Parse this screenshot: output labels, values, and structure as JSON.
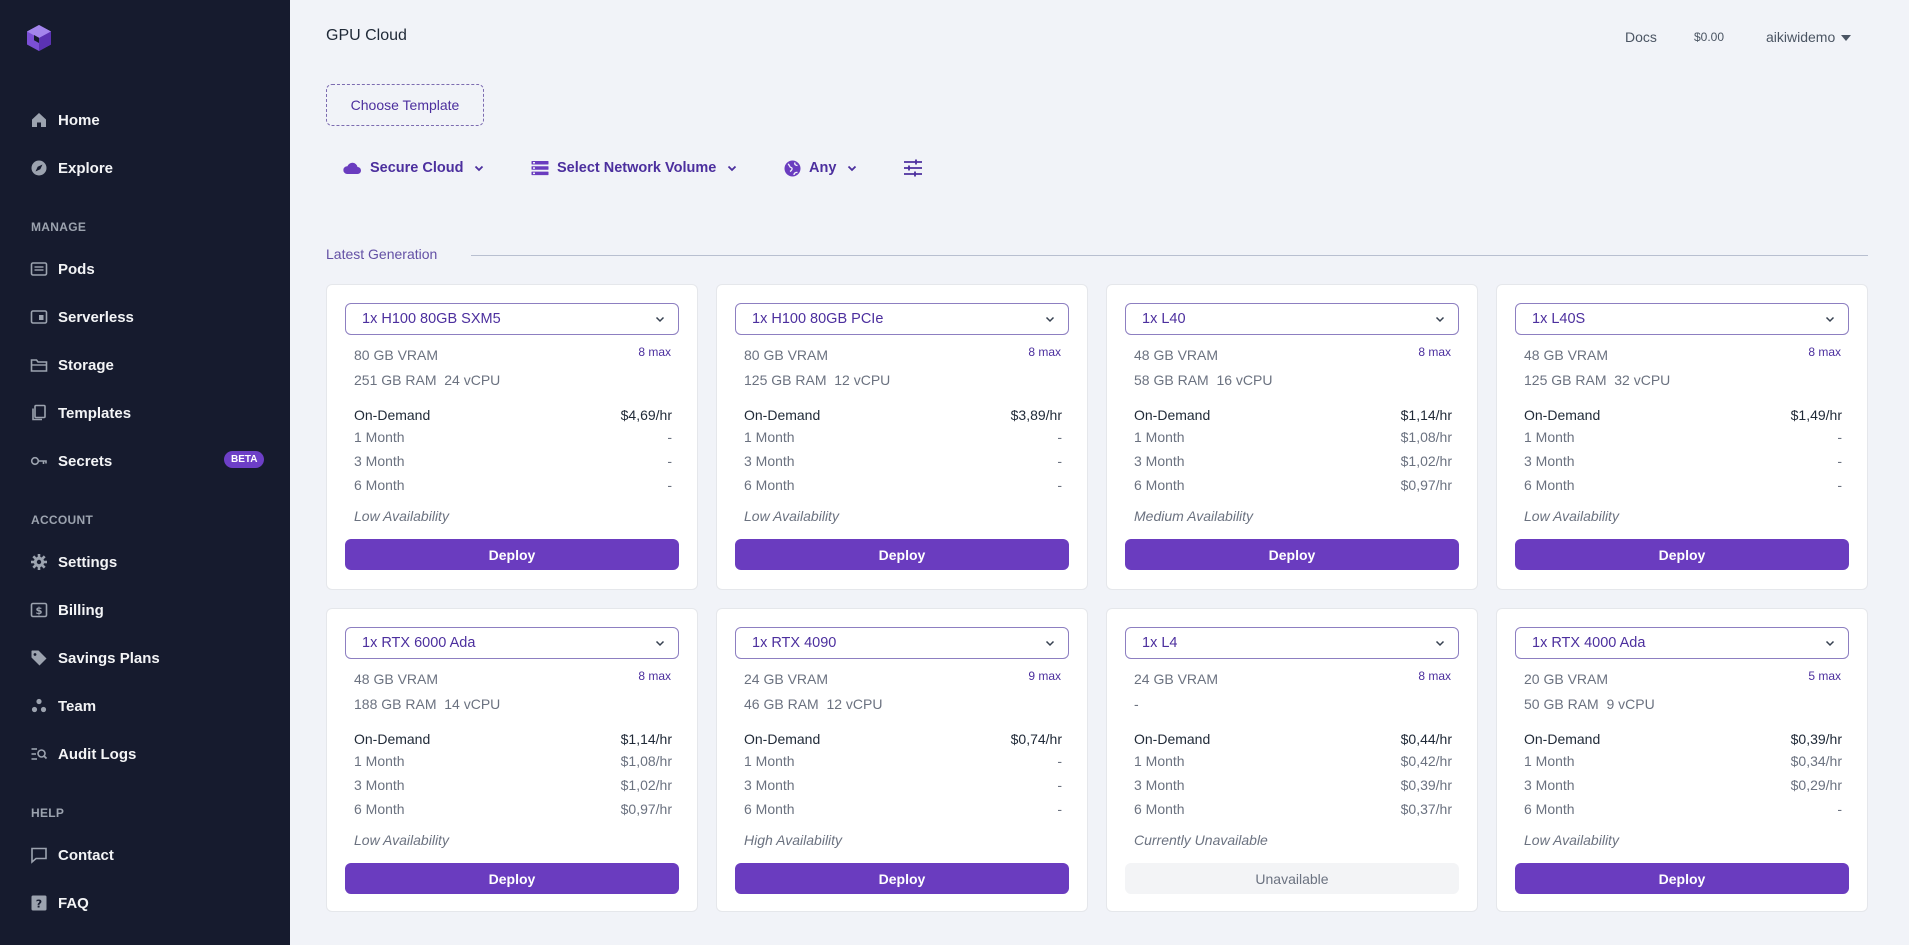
{
  "app": {
    "title": "GPU Cloud"
  },
  "header": {
    "docs": "Docs",
    "balance": "$0.00",
    "user": "aikiwidemo"
  },
  "sidebar": {
    "nav_top": [
      {
        "label": "Home",
        "icon": "home-icon"
      },
      {
        "label": "Explore",
        "icon": "compass-icon"
      }
    ],
    "manage_label": "MANAGE",
    "manage": [
      {
        "label": "Pods",
        "icon": "pods-icon"
      },
      {
        "label": "Serverless",
        "icon": "serverless-icon"
      },
      {
        "label": "Storage",
        "icon": "storage-icon"
      },
      {
        "label": "Templates",
        "icon": "templates-icon"
      },
      {
        "label": "Secrets",
        "icon": "key-icon",
        "badge": "BETA"
      }
    ],
    "account_label": "ACCOUNT",
    "account": [
      {
        "label": "Settings",
        "icon": "gear-icon"
      },
      {
        "label": "Billing",
        "icon": "billing-icon"
      },
      {
        "label": "Savings Plans",
        "icon": "tag-icon"
      },
      {
        "label": "Team",
        "icon": "team-icon"
      },
      {
        "label": "Audit Logs",
        "icon": "audit-icon"
      }
    ],
    "help_label": "HELP",
    "help": [
      {
        "label": "Contact",
        "icon": "chat-icon"
      },
      {
        "label": "FAQ",
        "icon": "question-icon"
      }
    ]
  },
  "main": {
    "choose_template": "Choose Template",
    "filters": {
      "cloud": "Secure Cloud",
      "volume": "Select Network Volume",
      "region": "Any"
    },
    "section_title": "Latest Generation",
    "price_labels": {
      "on_demand": "On-Demand",
      "m1": "1 Month",
      "m3": "3 Month",
      "m6": "6 Month"
    },
    "cards": [
      {
        "gpu": "1x H100 80GB SXM5",
        "vram": "80 GB VRAM",
        "max": "8 max",
        "ram_cpu": "251 GB RAM  24 vCPU",
        "on_demand": "$4,69/hr",
        "m1": "-",
        "m3": "-",
        "m6": "-",
        "availability": "Low Availability",
        "action": "Deploy",
        "available": true
      },
      {
        "gpu": "1x H100 80GB PCIe",
        "vram": "80 GB VRAM",
        "max": "8 max",
        "ram_cpu": "125 GB RAM  12 vCPU",
        "on_demand": "$3,89/hr",
        "m1": "-",
        "m3": "-",
        "m6": "-",
        "availability": "Low Availability",
        "action": "Deploy",
        "available": true
      },
      {
        "gpu": "1x L40",
        "vram": "48 GB VRAM",
        "max": "8 max",
        "ram_cpu": "58 GB RAM  16 vCPU",
        "on_demand": "$1,14/hr",
        "m1": "$1,08/hr",
        "m3": "$1,02/hr",
        "m6": "$0,97/hr",
        "availability": "Medium Availability",
        "action": "Deploy",
        "available": true
      },
      {
        "gpu": "1x L40S",
        "vram": "48 GB VRAM",
        "max": "8 max",
        "ram_cpu": "125 GB RAM  32 vCPU",
        "on_demand": "$1,49/hr",
        "m1": "-",
        "m3": "-",
        "m6": "-",
        "availability": "Low Availability",
        "action": "Deploy",
        "available": true
      },
      {
        "gpu": "1x RTX 6000 Ada",
        "vram": "48 GB VRAM",
        "max": "8 max",
        "ram_cpu": "188 GB RAM  14 vCPU",
        "on_demand": "$1,14/hr",
        "m1": "$1,08/hr",
        "m3": "$1,02/hr",
        "m6": "$0,97/hr",
        "availability": "Low Availability",
        "action": "Deploy",
        "available": true
      },
      {
        "gpu": "1x RTX 4090",
        "vram": "24 GB VRAM",
        "max": "9 max",
        "ram_cpu": "46 GB RAM  12 vCPU",
        "on_demand": "$0,74/hr",
        "m1": "-",
        "m3": "-",
        "m6": "-",
        "availability": "High Availability",
        "action": "Deploy",
        "available": true
      },
      {
        "gpu": "1x L4",
        "vram": "24 GB VRAM",
        "max": "8 max",
        "ram_cpu": "-",
        "on_demand": "$0,44/hr",
        "m1": "$0,42/hr",
        "m3": "$0,39/hr",
        "m6": "$0,37/hr",
        "availability": "Currently Unavailable",
        "action": "Unavailable",
        "available": false
      },
      {
        "gpu": "1x RTX 4000 Ada",
        "vram": "20 GB VRAM",
        "max": "5 max",
        "ram_cpu": "50 GB RAM  9 vCPU",
        "on_demand": "$0,39/hr",
        "m1": "$0,34/hr",
        "m3": "$0,29/hr",
        "m6": "-",
        "availability": "Low Availability",
        "action": "Deploy",
        "available": true
      }
    ]
  },
  "colors": {
    "sidebar_bg": "#161b2e",
    "accent": "#6a3cbf",
    "page_bg": "#f1f3f8"
  }
}
